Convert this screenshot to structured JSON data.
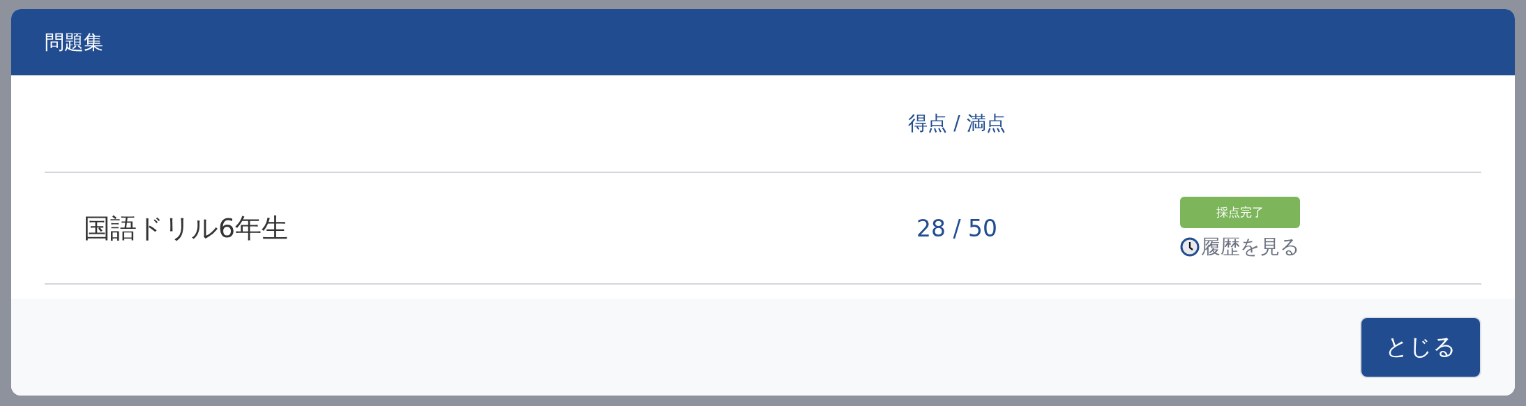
{
  "dialog": {
    "title": "問題集"
  },
  "table": {
    "score_column_header": "得点 / 満点",
    "rows": [
      {
        "name": "国語ドリル6年生",
        "score": "28 / 50",
        "status": {
          "label": "採点完了",
          "color": "#7cb55a"
        },
        "history_link": "履歴を見る"
      }
    ]
  },
  "footer": {
    "buttons": [
      "とじる"
    ]
  }
}
